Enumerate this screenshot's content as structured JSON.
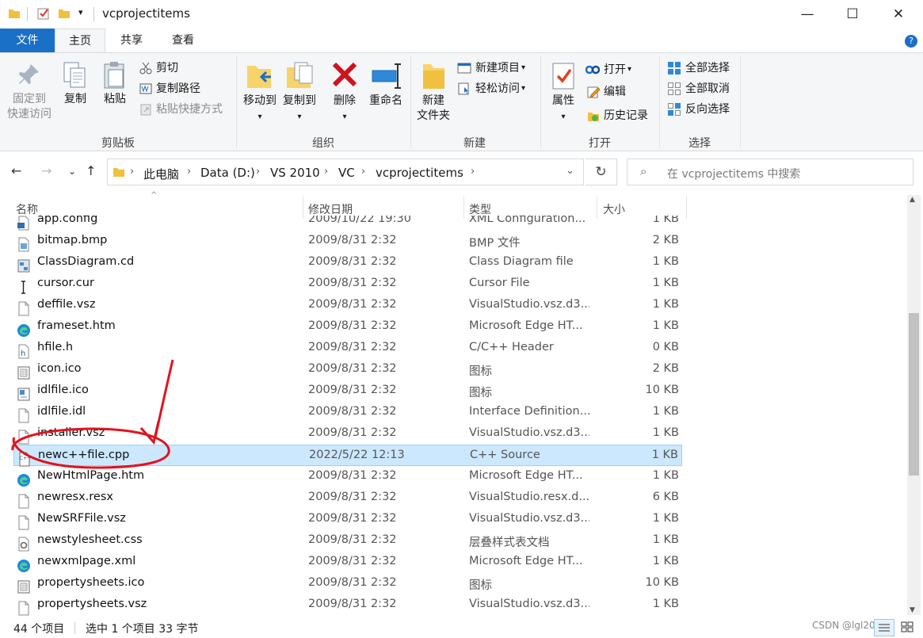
{
  "window": {
    "title": "vcprojectitems",
    "minimize": "—",
    "maximize": "☐",
    "close": "✕"
  },
  "tabs": {
    "file": "文件",
    "home": "主页",
    "share": "共享",
    "view": "查看"
  },
  "ribbon": {
    "clipboard": {
      "label": "剪贴板",
      "pin_line1": "固定到",
      "pin_line2": "快速访问",
      "copy": "复制",
      "paste": "粘贴",
      "cut": "剪切",
      "copy_path": "复制路径",
      "paste_shortcut": "粘贴快捷方式"
    },
    "organize": {
      "label": "组织",
      "move_to": "移动到",
      "copy_to": "复制到",
      "delete": "删除",
      "rename": "重命名"
    },
    "new": {
      "label": "新建",
      "new_folder_line1": "新建",
      "new_folder_line2": "文件夹",
      "new_item": "新建项目",
      "easy_access": "轻松访问"
    },
    "open": {
      "label": "打开",
      "properties": "属性",
      "open": "打开",
      "edit": "编辑",
      "history": "历史记录"
    },
    "select": {
      "label": "选择",
      "select_all": "全部选择",
      "select_none": "全部取消",
      "invert": "反向选择"
    }
  },
  "address": {
    "crumbs": [
      "此电脑",
      "Data (D:)",
      "VS 2010",
      "VC",
      "vcprojectitems"
    ],
    "search_placeholder": "在 vcprojectitems 中搜索"
  },
  "columns": {
    "name": "名称",
    "date": "修改日期",
    "type": "类型",
    "size": "大小"
  },
  "files": [
    {
      "name": "app.config",
      "date": "2009/10/22 19:30",
      "type": "XML Configuration...",
      "size": "1 KB",
      "icon": "config"
    },
    {
      "name": "bitmap.bmp",
      "date": "2009/8/31 2:32",
      "type": "BMP 文件",
      "size": "2 KB",
      "icon": "bmp"
    },
    {
      "name": "ClassDiagram.cd",
      "date": "2009/8/31 2:32",
      "type": "Class Diagram file",
      "size": "1 KB",
      "icon": "cd"
    },
    {
      "name": "cursor.cur",
      "date": "2009/8/31 2:32",
      "type": "Cursor File",
      "size": "1 KB",
      "icon": "cursor"
    },
    {
      "name": "deffile.vsz",
      "date": "2009/8/31 2:32",
      "type": "VisualStudio.vsz.d3...",
      "size": "1 KB",
      "icon": "blank"
    },
    {
      "name": "frameset.htm",
      "date": "2009/8/31 2:32",
      "type": "Microsoft Edge HT...",
      "size": "1 KB",
      "icon": "edge"
    },
    {
      "name": "hfile.h",
      "date": "2009/8/31 2:32",
      "type": "C/C++ Header",
      "size": "0 KB",
      "icon": "h"
    },
    {
      "name": "icon.ico",
      "date": "2009/8/31 2:32",
      "type": "图标",
      "size": "2 KB",
      "icon": "ico"
    },
    {
      "name": "idlfile.ico",
      "date": "2009/8/31 2:32",
      "type": "图标",
      "size": "10 KB",
      "icon": "ico2"
    },
    {
      "name": "idlfile.idl",
      "date": "2009/8/31 2:32",
      "type": "Interface Definition...",
      "size": "1 KB",
      "icon": "blank"
    },
    {
      "name": "installer.vsz",
      "date": "2009/8/31 2:32",
      "type": "VisualStudio.vsz.d3...",
      "size": "1 KB",
      "icon": "blank"
    },
    {
      "name": "newc++file.cpp",
      "date": "2022/5/22 12:13",
      "type": "C++ Source",
      "size": "1 KB",
      "icon": "cpp",
      "selected": true
    },
    {
      "name": "NewHtmlPage.htm",
      "date": "2009/8/31 2:32",
      "type": "Microsoft Edge HT...",
      "size": "1 KB",
      "icon": "edge"
    },
    {
      "name": "newresx.resx",
      "date": "2009/8/31 2:32",
      "type": "VisualStudio.resx.d...",
      "size": "6 KB",
      "icon": "blank"
    },
    {
      "name": "NewSRFFile.vsz",
      "date": "2009/8/31 2:32",
      "type": "VisualStudio.vsz.d3...",
      "size": "1 KB",
      "icon": "blank"
    },
    {
      "name": "newstylesheet.css",
      "date": "2009/8/31 2:32",
      "type": "层叠样式表文档",
      "size": "1 KB",
      "icon": "css"
    },
    {
      "name": "newxmlpage.xml",
      "date": "2009/8/31 2:32",
      "type": "Microsoft Edge HT...",
      "size": "1 KB",
      "icon": "edge"
    },
    {
      "name": "propertysheets.ico",
      "date": "2009/8/31 2:32",
      "type": "图标",
      "size": "10 KB",
      "icon": "ico"
    },
    {
      "name": "propertysheets.vsz",
      "date": "2009/8/31 2:32",
      "type": "VisualStudio.vsz.d3...",
      "size": "1 KB",
      "icon": "blank"
    }
  ],
  "status": {
    "count": "44 个项目",
    "selection": "选中 1 个项目  33 字节",
    "watermark": "CSDN @lgl208"
  },
  "colors": {
    "accent": "#1a6fc7",
    "selection": "#cce8ff",
    "annotation": "#e0141e"
  }
}
